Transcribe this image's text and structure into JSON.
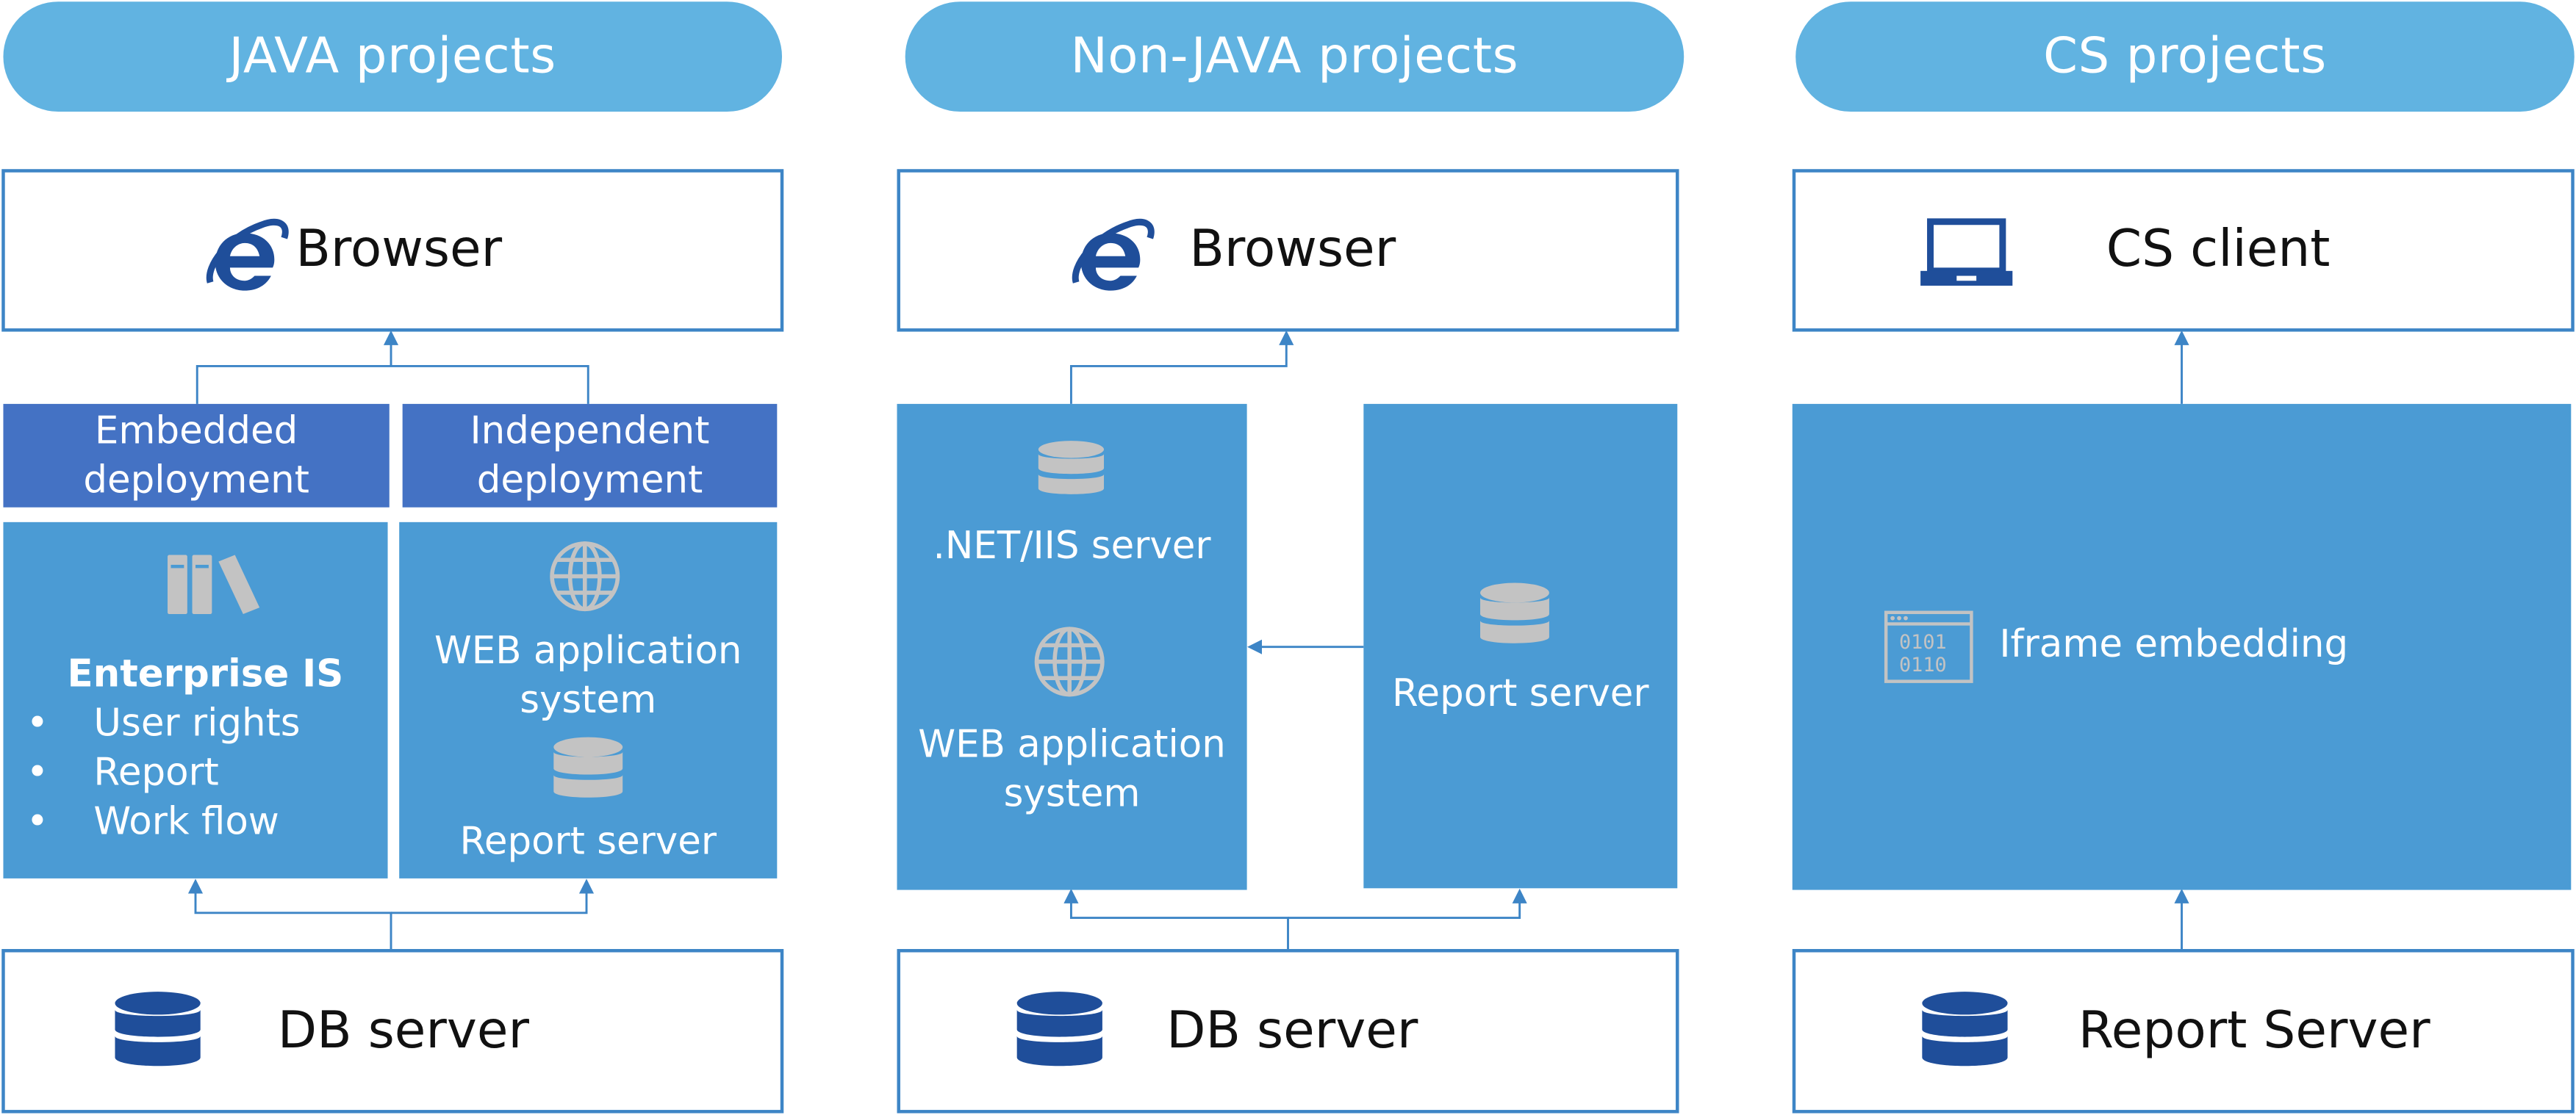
{
  "colors": {
    "header_pill": "#61b3e1",
    "outline": "#3d85c6",
    "component_block": "#4b9bd4",
    "deployment_header": "#4472c4",
    "icon_navy": "#1f4e9a",
    "icon_gray": "#c3c3c3",
    "connector": "#3d85c6"
  },
  "java": {
    "title": "JAVA projects",
    "browser": {
      "label": "Browser",
      "icon": "ie-browser-icon"
    },
    "embedded": {
      "line1": "Embedded",
      "line2": "deployment",
      "icon": "books-icon",
      "name": "Enterprise IS",
      "bullets": [
        "User rights",
        "Report",
        "Work flow"
      ],
      "bullet_char": "•"
    },
    "independent": {
      "line1": "Independent",
      "line2": "deployment",
      "icon1": "globe-icon",
      "app_line1": "WEB application",
      "app_line2": "system",
      "icon2": "database-icon",
      "server": "Report server"
    },
    "db": {
      "label": "DB server",
      "icon": "database-icon"
    }
  },
  "nonjava": {
    "title": "Non-JAVA projects",
    "browser": {
      "label": "Browser",
      "icon": "ie-browser-icon"
    },
    "left": {
      "icon1": "database-icon",
      "server": ".NET/IIS server",
      "icon2": "globe-icon",
      "app_line1": "WEB application",
      "app_line2": "system"
    },
    "right": {
      "icon": "database-icon",
      "server": "Report server"
    },
    "db": {
      "label": "DB server",
      "icon": "database-icon"
    }
  },
  "cs": {
    "title": "CS projects",
    "client": {
      "label": "CS client",
      "icon": "laptop-icon"
    },
    "block": {
      "icon": "binary-window-icon",
      "label": "Iframe embedding"
    },
    "server": {
      "label": "Report Server",
      "icon": "database-icon"
    }
  }
}
